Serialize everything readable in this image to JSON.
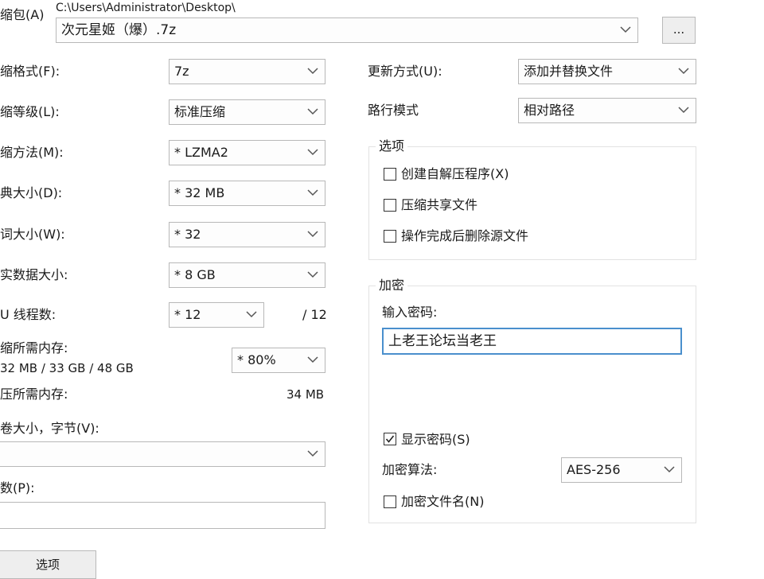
{
  "archive": {
    "label": "缩包(A)",
    "path": "C:\\Users\\Administrator\\Desktop\\",
    "filename": "次元星姬（爆）.7z",
    "browse_label": "..."
  },
  "left": {
    "format": {
      "label": "缩格式(F):",
      "value": "7z"
    },
    "level": {
      "label": "缩等级(L):",
      "value": "标准压缩"
    },
    "method": {
      "label": "缩方法(M):",
      "value": "* LZMA2"
    },
    "dict": {
      "label": "典大小(D):",
      "value": "* 32 MB"
    },
    "word": {
      "label": "词大小(W):",
      "value": "* 32"
    },
    "solid": {
      "label": "实数据大小:",
      "value": "* 8 GB"
    },
    "threads": {
      "label": "U 线程数:",
      "value": "* 12",
      "total": "/ 12"
    },
    "mem_comp": {
      "label": "缩所需内存:",
      "detail": "32 MB / 33 GB / 48 GB",
      "value": "* 80%"
    },
    "mem_decomp": {
      "label": "压所需内存:",
      "value": "34 MB"
    },
    "volume": {
      "label": "卷大小，字节(V):",
      "value": ""
    },
    "params": {
      "label": "数(P):",
      "value": ""
    },
    "options_button": "选项"
  },
  "right": {
    "update": {
      "label": "更新方式(U):",
      "value": "添加并替换文件"
    },
    "pathmode": {
      "label": "路行模式",
      "value": "相对路径"
    },
    "options": {
      "title": "选项",
      "sfx": "创建自解压程序(X)",
      "shared": "压缩共享文件",
      "delete": "操作完成后删除源文件"
    },
    "encryption": {
      "title": "加密",
      "pw_label": "输入密码:",
      "pw_value": "上老王论坛当老王",
      "show_pw": "显示密码(S)",
      "algo_label": "加密算法:",
      "algo_value": "AES-256",
      "enc_names": "加密文件名(N)"
    }
  },
  "icons": {
    "chevron": "chevron-down-icon",
    "check": "checkmark-icon"
  }
}
